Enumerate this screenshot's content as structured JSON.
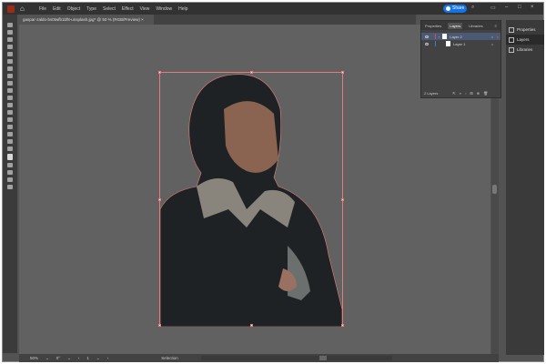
{
  "menubar": {
    "items": [
      "File",
      "Edit",
      "Object",
      "Type",
      "Select",
      "Effect",
      "View",
      "Window",
      "Help"
    ],
    "share": "Share"
  },
  "document": {
    "tab": "gaspar-zaldo-bs0twfb1bf8-unsplash.jpg* @ 50 % (RGB/Preview)"
  },
  "layers_panel": {
    "tabs": [
      "Properties",
      "Layers",
      "Libraries"
    ],
    "active_tab": "Layers",
    "layers": [
      {
        "name": "Layer 2",
        "color": "#e34850",
        "selected": true
      },
      {
        "name": "Layer 1",
        "color": "#4b6ee3",
        "selected": false
      }
    ],
    "count": "2 Layers"
  },
  "right_panel": {
    "items": [
      {
        "label": "Properties",
        "icon": "properties-icon"
      },
      {
        "label": "Layers",
        "icon": "layers-icon",
        "active": true
      },
      {
        "label": "Libraries",
        "icon": "libraries-icon"
      }
    ]
  },
  "status": {
    "zoom": "50%",
    "rotation": "0°",
    "artboard": "1",
    "tool": "Selection"
  }
}
